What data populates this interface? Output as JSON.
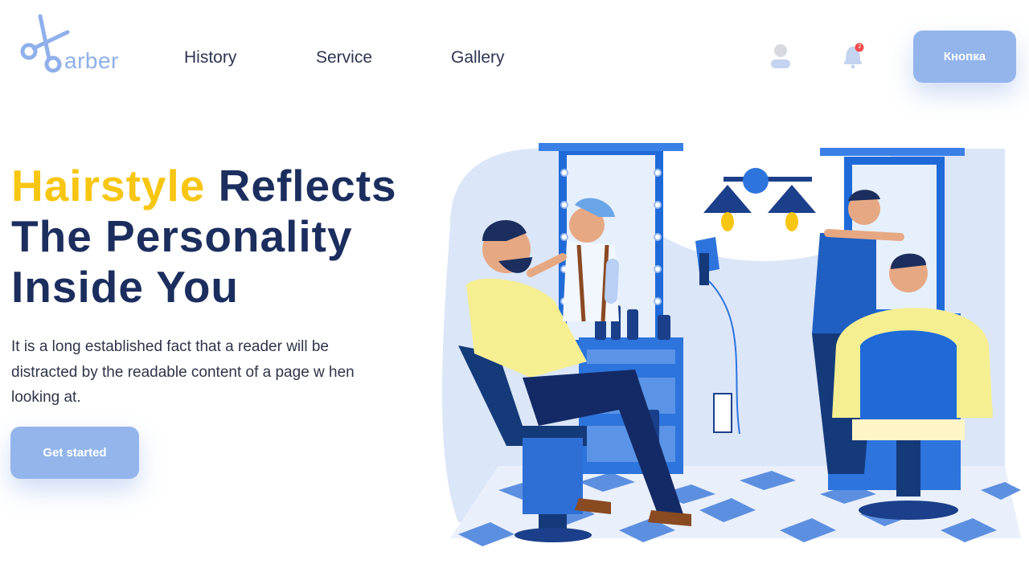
{
  "header": {
    "logo_text": "arber",
    "nav": [
      {
        "label": "History"
      },
      {
        "label": "Service"
      },
      {
        "label": "Gallery"
      }
    ],
    "notification_count": "2",
    "button_label": "Кнопка"
  },
  "hero": {
    "headline_accent": "Hairstyle",
    "headline_rest_1": " Reflects",
    "headline_line_2": "The Personality",
    "headline_line_3": "Inside You",
    "description": "It is a long established fact that a reader will be distracted by the readable content of a page w hen looking at.",
    "cta_label": "Get started"
  },
  "colors": {
    "accent_yellow": "#f7c613",
    "headline_navy": "#1b2e5e",
    "button_blue": "#93b5ec",
    "logo_blue": "#8fb0ea"
  },
  "icons": {
    "logo": "scissors-icon",
    "user": "user-icon",
    "notifications": "bell-icon"
  },
  "illustration": {
    "subject": "barbershop-scene"
  }
}
